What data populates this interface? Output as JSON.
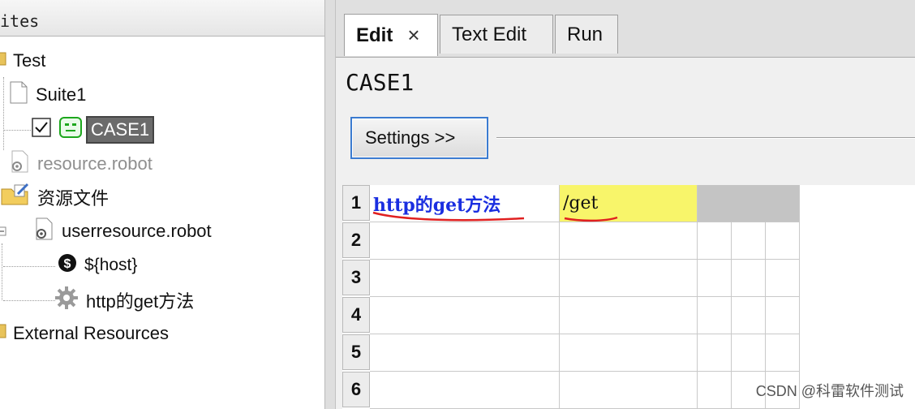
{
  "left_panel": {
    "header": "ites",
    "tree": {
      "test": "Test",
      "suite1": "Suite1",
      "case1": "CASE1",
      "resource_robot": "resource.robot",
      "resource_folder": "资源文件",
      "userresource": "userresource.robot",
      "host_var": "${host}",
      "keyword": "http的get方法",
      "external": "External Resources"
    }
  },
  "tabs": [
    {
      "label": "Edit",
      "close": "×"
    },
    {
      "label": "Text Edit"
    },
    {
      "label": "Run"
    }
  ],
  "editor": {
    "case_title": "CASE1",
    "settings_button": "Settings >>",
    "rows": [
      {
        "num": "1",
        "col1": "http的get方法",
        "col2": "/get"
      },
      {
        "num": "2"
      },
      {
        "num": "3"
      },
      {
        "num": "4"
      },
      {
        "num": "5"
      },
      {
        "num": "6"
      }
    ]
  },
  "watermark": "CSDN @科雷软件测试",
  "colors": {
    "keyword_text": "#1a2ee0",
    "arg_highlight": "#f8f56a",
    "underline_red": "#e02020",
    "selection": "#6b6b6b",
    "focus_border": "#3b7bd0"
  }
}
